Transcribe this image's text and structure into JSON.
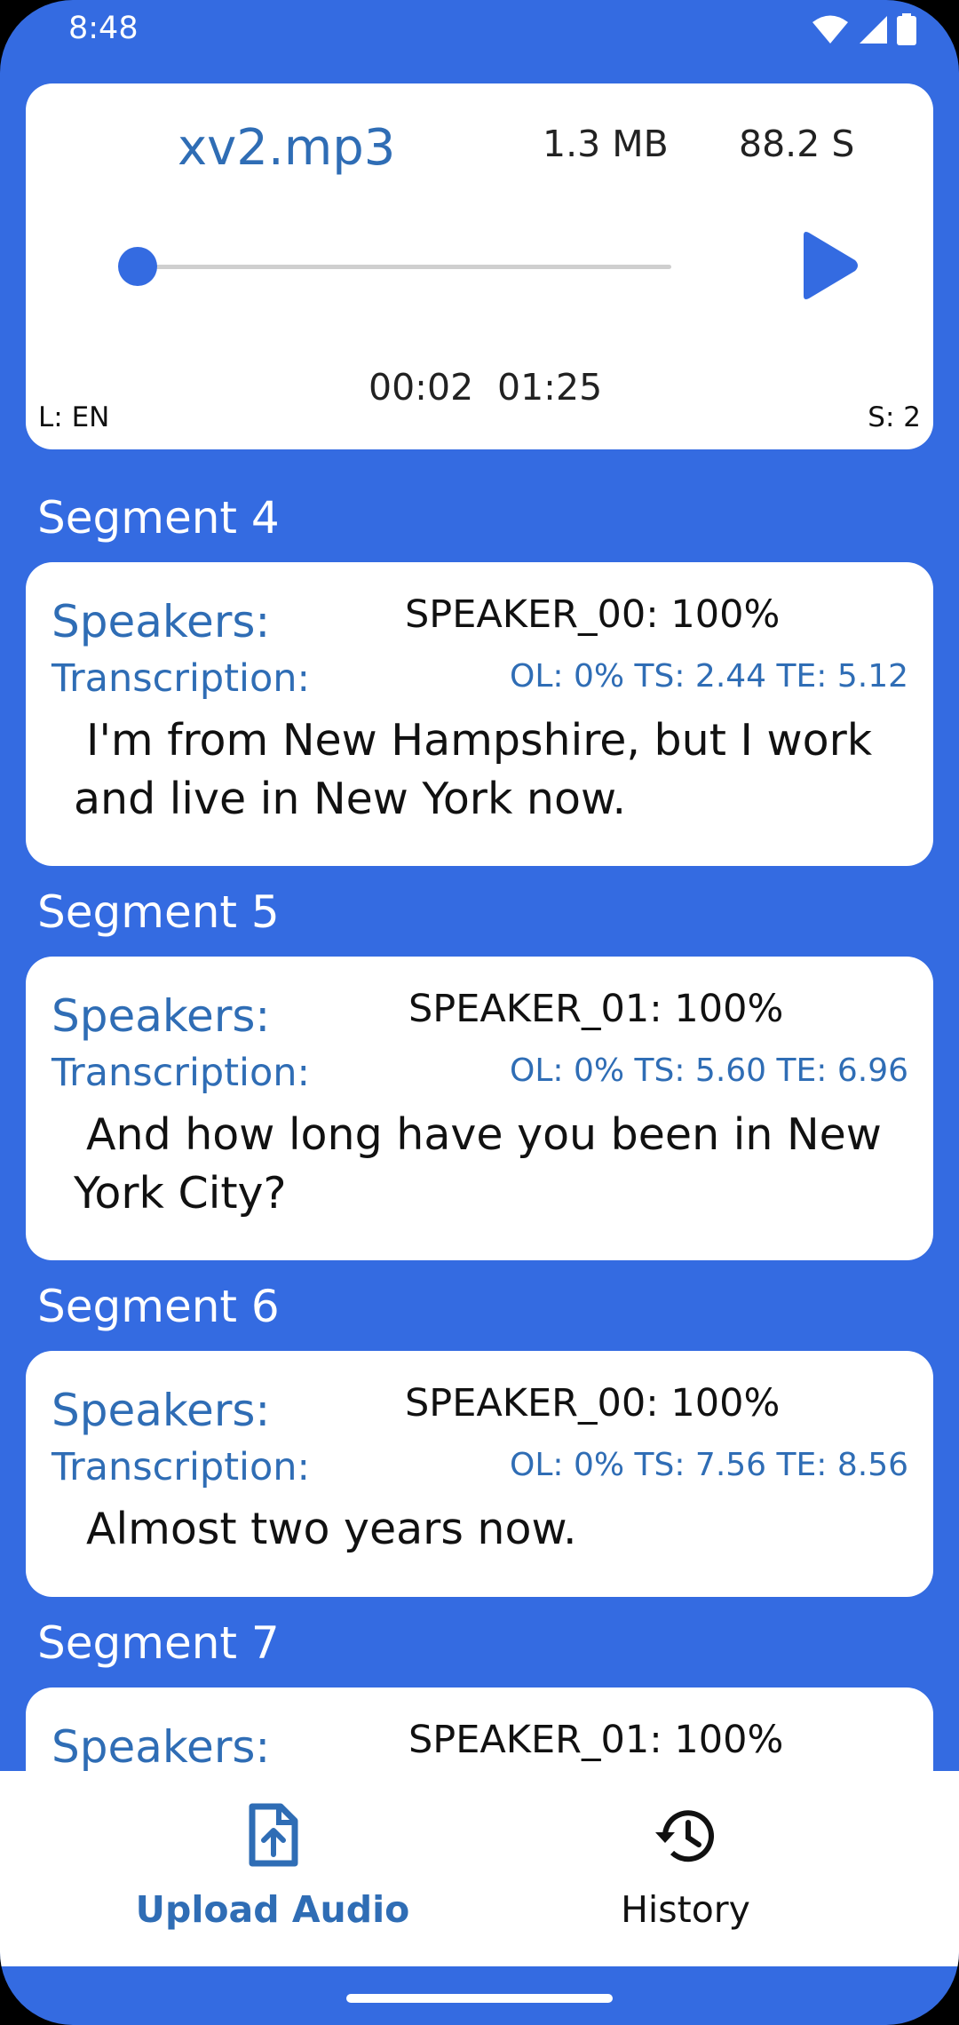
{
  "status_bar": {
    "time": "8:48"
  },
  "player": {
    "file_name": "xv2.mp3",
    "file_size": "1.3 MB",
    "duration": "88.2 S",
    "current_time": "00:02",
    "total_time": "01:25",
    "progress": 0.02,
    "language": "L: EN",
    "speakers": "S: 2"
  },
  "labels": {
    "speakers": "Speakers:",
    "transcription": "Transcription:"
  },
  "segments": [
    {
      "title": "Segment 4",
      "speaker": "SPEAKER_00: 100%",
      "meta": "OL: 0% TS: 2.44 TE: 5.12",
      "text": "I'm from New Hampshire, but I work and live in New York now."
    },
    {
      "title": "Segment 5",
      "speaker": "SPEAKER_01: 100%",
      "meta": "OL: 0% TS: 5.60 TE: 6.96",
      "text": "And how long have you been in New York City?"
    },
    {
      "title": "Segment 6",
      "speaker": "SPEAKER_00: 100%",
      "meta": "OL: 0% TS: 7.56 TE: 8.56",
      "text": "Almost two years now."
    },
    {
      "title": "Segment 7",
      "speaker": "SPEAKER_01: 100%"
    }
  ],
  "nav": {
    "upload_label": "Upload Audio",
    "history_label": "History"
  },
  "colors": {
    "accent": "#346be1",
    "label_blue": "#2f6db5"
  }
}
